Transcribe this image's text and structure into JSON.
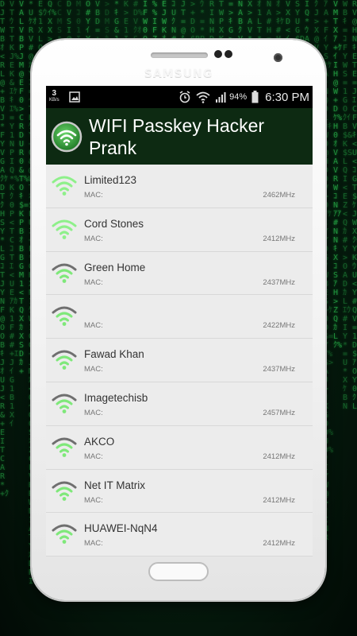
{
  "phone": {
    "brand": "SAMSUNG"
  },
  "status_bar": {
    "data_rate": "3",
    "data_rate_unit": "KB/s",
    "battery": "94%",
    "time": "6:30 PM"
  },
  "app": {
    "title": "WIFI Passkey Hacker Prank"
  },
  "colors": {
    "app_bar": "#0d2a12",
    "wifi_strong": "#8ef08a",
    "wifi_weak": "#6f6f6f",
    "accent_green": "#7fe87a"
  },
  "networks": [
    {
      "ssid": "Limited123",
      "mac_label": "MAC:",
      "frequency": "2462MHz",
      "signal_icon": "wifi-full-green-icon"
    },
    {
      "ssid": "Cord Stones",
      "mac_label": "MAC:",
      "frequency": "2412MHz",
      "signal_icon": "wifi-full-green-icon"
    },
    {
      "ssid": "Green Home",
      "mac_label": "MAC:",
      "frequency": "2437MHz",
      "signal_icon": "wifi-partial-icon"
    },
    {
      "ssid": "",
      "mac_label": "MAC:",
      "frequency": "2422MHz",
      "signal_icon": "wifi-partial-icon"
    },
    {
      "ssid": "Fawad Khan",
      "mac_label": "MAC:",
      "frequency": "2437MHz",
      "signal_icon": "wifi-partial-icon"
    },
    {
      "ssid": "Imagetechisb",
      "mac_label": "MAC:",
      "frequency": "2457MHz",
      "signal_icon": "wifi-partial-icon"
    },
    {
      "ssid": "AKCO",
      "mac_label": "MAC:",
      "frequency": "2412MHz",
      "signal_icon": "wifi-partial-icon"
    },
    {
      "ssid": "Net IT Matrix",
      "mac_label": "MAC:",
      "frequency": "2412MHz",
      "signal_icon": "wifi-partial-icon"
    },
    {
      "ssid": "HUAWEI-NqN4",
      "mac_label": "MAC:",
      "frequency": "2412MHz",
      "signal_icon": "wifi-partial-icon"
    }
  ]
}
